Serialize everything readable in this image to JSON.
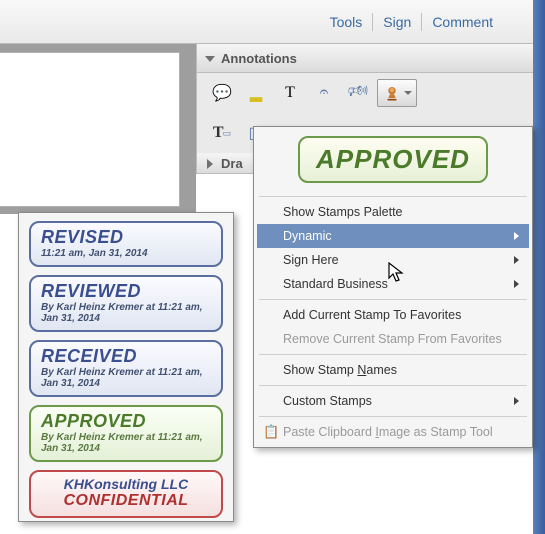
{
  "topbar": {
    "tools": "Tools",
    "sign": "Sign",
    "comment": "Comment"
  },
  "panel": {
    "annotations_header": "Annotations",
    "drawing_header": "Dra",
    "tools_row1": {
      "sticky_note": "sticky-note-icon",
      "highlighter": "highlighter-icon",
      "text_tool": "T",
      "attach": "attach-icon",
      "audio": "audio-icon",
      "stamp": "stamp-icon"
    },
    "tools_row2": {
      "textbox": "T",
      "callout": "callout-icon"
    }
  },
  "dropdown": {
    "preview_label": "APPROVED",
    "items": [
      {
        "label": "Show Stamps Palette",
        "submenu": false,
        "highlighted": false
      },
      {
        "label": "Dynamic",
        "submenu": true,
        "highlighted": true
      },
      {
        "label": "Sign Here",
        "submenu": true,
        "highlighted": false
      },
      {
        "label": "Standard Business",
        "submenu": true,
        "highlighted": false
      }
    ],
    "items2": [
      {
        "label": "Add Current Stamp To Favorites",
        "disabled": false
      },
      {
        "label": "Remove Current Stamp From Favorites",
        "disabled": true
      }
    ],
    "show_names_pre": "Show Stamp ",
    "show_names_u": "N",
    "show_names_post": "ames",
    "custom_stamps": "Custom Stamps",
    "paste_pre": "Paste Clipboard ",
    "paste_u": "I",
    "paste_post": "mage as Stamp Tool"
  },
  "dynamic_flyout": [
    {
      "style": "blue",
      "title": "REVISED",
      "sub": "11:21 am, Jan 31, 2014"
    },
    {
      "style": "blue",
      "title": "REVIEWED",
      "sub": "By Karl Heinz Kremer at 11:21 am, Jan 31, 2014"
    },
    {
      "style": "blue",
      "title": "RECEIVED",
      "sub": "By Karl Heinz Kremer at 11:21 am, Jan 31, 2014"
    },
    {
      "style": "green",
      "title": "APPROVED",
      "sub": "By Karl Heinz Kremer at 11:21 am, Jan 31, 2014"
    },
    {
      "style": "red",
      "line1": "KHKonsulting LLC",
      "line2": "CONFIDENTIAL"
    }
  ]
}
